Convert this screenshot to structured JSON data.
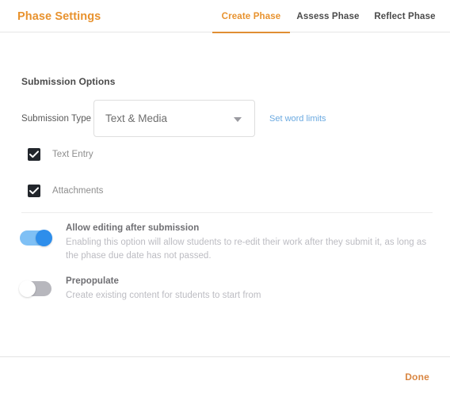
{
  "header": {
    "title": "Phase Settings",
    "tabs": [
      {
        "label": "Create Phase",
        "active": true
      },
      {
        "label": "Assess Phase",
        "active": false
      },
      {
        "label": "Reflect Phase",
        "active": false
      }
    ]
  },
  "main": {
    "section_title": "Submission Options",
    "submission_type": {
      "label": "Submission Type",
      "selected": "Text & Media",
      "options": [
        "Text & Media"
      ],
      "word_limits_link": "Set word limits"
    },
    "checkboxes": [
      {
        "label": "Text Entry",
        "checked": true
      },
      {
        "label": "Attachments",
        "checked": true
      }
    ],
    "toggles": [
      {
        "title": "Allow editing after submission",
        "description": "Enabling this option will allow students to re-edit their work after they submit it, as long as the phase due date has not passed.",
        "on": true
      },
      {
        "title": "Prepopulate",
        "description": "Create existing content for students to start from",
        "on": false
      }
    ]
  },
  "footer": {
    "done_label": "Done"
  },
  "colors": {
    "brand_orange": "#e8922e",
    "tab_underline": "#e08e33",
    "link_blue": "#6aa9e0",
    "toggle_on_track": "#7fc0f5",
    "toggle_on_knob": "#2e8eeb",
    "toggle_off_track": "#b7b7bd",
    "checkbox_fill": "#22262c",
    "done_orange": "#d98642"
  }
}
